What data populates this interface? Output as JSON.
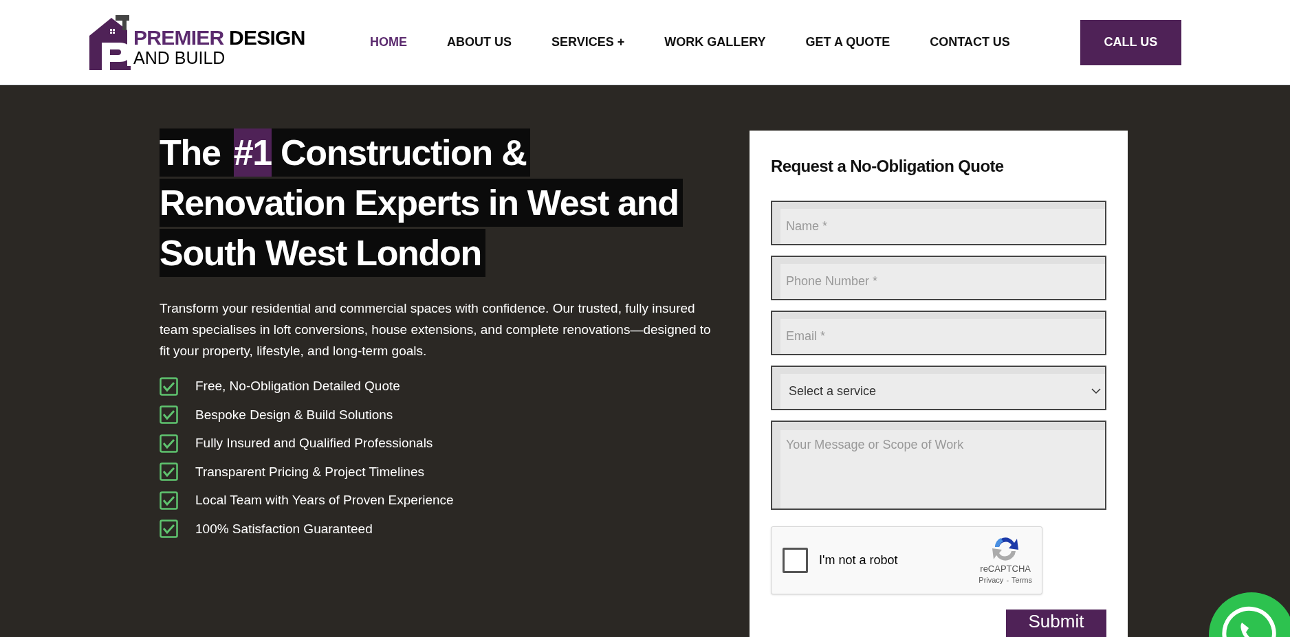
{
  "header": {
    "logo": {
      "accent": "PREMIER",
      "word": "DESIGN",
      "line2": "AND BUILD"
    },
    "nav": [
      {
        "label": "HOME",
        "selected": true
      },
      {
        "label": "ABOUT US",
        "selected": false
      },
      {
        "label": "SERVICES +",
        "selected": false
      },
      {
        "label": "WORK GALLERY",
        "selected": false
      },
      {
        "label": "GET A QUOTE",
        "selected": false
      },
      {
        "label": "CONTACT US",
        "selected": false
      }
    ],
    "cta": "CALL US"
  },
  "hero": {
    "heading": [
      [
        {
          "text": "The ",
          "highlighted": false
        },
        {
          "text": "#1",
          "highlighted": true
        },
        {
          "text": " Construction &",
          "highlighted": false
        }
      ],
      [
        {
          "text": "Renovation Experts in West and",
          "highlighted": false
        }
      ],
      [
        {
          "text": "South West London",
          "highlighted": false
        }
      ]
    ],
    "intro": "Transform your residential and commercial spaces with confidence. Our trusted, fully insured team specialises in loft conversions, house extensions, and complete renovations—designed to fit your property, lifestyle, and long-term goals.",
    "benefits": [
      "Free, No-Obligation Detailed Quote",
      "Bespoke Design & Build Solutions",
      "Fully Insured and Qualified Professionals",
      "Transparent Pricing & Project Timelines",
      "Local Team with Years of Proven Experience",
      "100% Satisfaction Guaranteed"
    ]
  },
  "form": {
    "title": "Request a No-Obligation Quote",
    "fields": [
      {
        "kind": "input",
        "placeholder": "Name *"
      },
      {
        "kind": "input",
        "placeholder": "Phone Number *"
      },
      {
        "kind": "input",
        "placeholder": "Email *"
      },
      {
        "kind": "select",
        "value": "Select a service"
      },
      {
        "kind": "textarea",
        "placeholder": "Your Message or Scope of Work"
      }
    ],
    "captcha": {
      "label": "I'm not a robot",
      "checked": false,
      "brand": "reCAPTCHA",
      "privacy": "Privacy",
      "separator": "-",
      "terms": "Terms"
    },
    "submit": "Submit"
  }
}
